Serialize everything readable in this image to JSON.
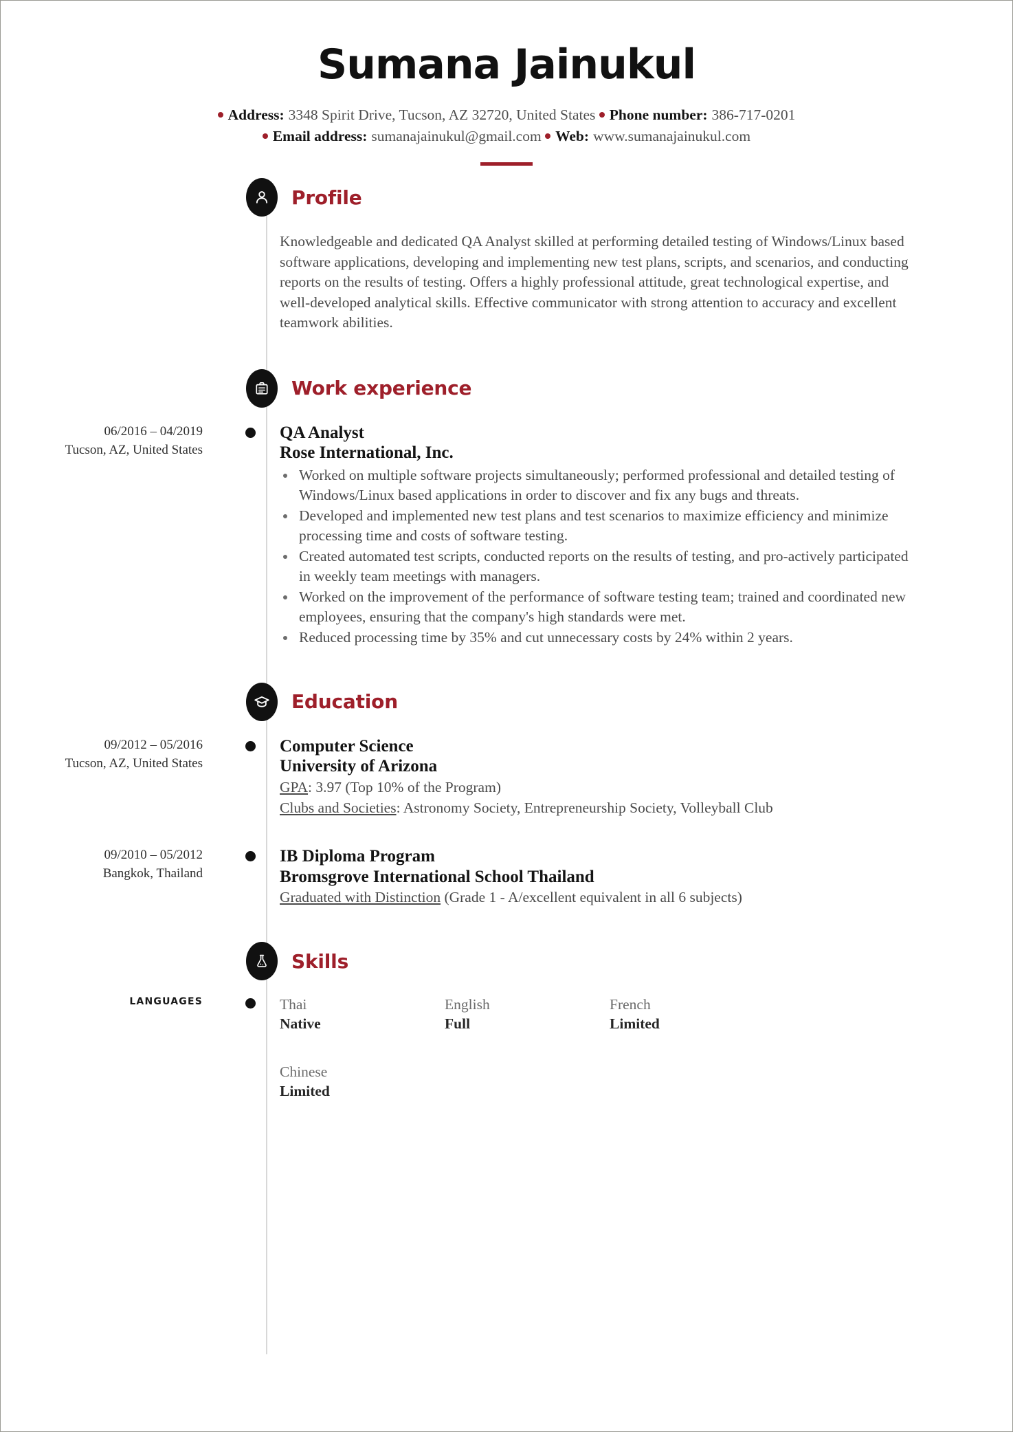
{
  "header": {
    "full_name": "Sumana Jainukul",
    "contact_line_1": [
      {
        "label": "Address:",
        "value": "3348 Spirit Drive, Tucson, AZ 32720, United States"
      },
      {
        "label": "Phone number:",
        "value": "386-717-0201"
      }
    ],
    "contact_line_2": [
      {
        "label": "Email address:",
        "value": "sumanajainukul@gmail.com"
      },
      {
        "label": "Web:",
        "value": "www.sumanajainukul.com"
      }
    ]
  },
  "accent_color": "#9e1f2a",
  "sections": {
    "profile": {
      "title": "Profile",
      "icon": "person-icon",
      "text": "Knowledgeable and dedicated QA Analyst skilled at performing detailed testing of Windows/Linux based software applications, developing and implementing new test plans, scripts, and scenarios, and conducting reports on the results of testing. Offers a highly professional attitude, great technological expertise, and well-developed analytical skills. Effective communicator with strong attention to accuracy and excellent teamwork abilities."
    },
    "work_experience": {
      "title": "Work experience",
      "icon": "briefcase-icon",
      "entries": [
        {
          "date": "06/2016 – 04/2019",
          "location": "Tucson, AZ, United States",
          "title": "QA Analyst",
          "organization": "Rose International, Inc.",
          "bullets": [
            "Worked on multiple software projects simultaneously; performed professional and detailed testing of Windows/Linux based applications in order to discover and fix any bugs and threats.",
            "Developed and implemented new test plans and test scenarios to maximize efficiency and minimize processing time and costs of software testing.",
            "Created automated test scripts, conducted reports on the results of testing, and pro-actively participated in weekly team meetings with managers.",
            "Worked on the improvement of the performance of software testing team; trained and coordinated new employees, ensuring that the company's high standards were met.",
            "Reduced processing time by 35% and cut unnecessary costs by 24% within 2 years."
          ]
        }
      ]
    },
    "education": {
      "title": "Education",
      "icon": "graduation-cap-icon",
      "entries": [
        {
          "date": "09/2012 – 05/2016",
          "location": "Tucson, AZ, United States",
          "degree": "Computer Science",
          "school": "University of Arizona",
          "details": [
            {
              "label": "GPA",
              "rest": ": 3.97 (Top 10% of the Program)"
            },
            {
              "label": "Clubs and Societies",
              "rest": ": Astronomy Society, Entrepreneurship Society, Volleyball Club"
            }
          ]
        },
        {
          "date": "09/2010 – 05/2012",
          "location": "Bangkok, Thailand",
          "degree": "IB Diploma Program",
          "school": "Bromsgrove International School Thailand",
          "details": [
            {
              "label": "Graduated with Distinction",
              "rest": " (Grade 1 - A/excellent equivalent in all 6 subjects)"
            }
          ]
        }
      ]
    },
    "skills": {
      "title": "Skills",
      "icon": "flask-icon",
      "group_label": "LANGUAGES",
      "languages": [
        {
          "name": "Thai",
          "level": "Native"
        },
        {
          "name": "English",
          "level": "Full"
        },
        {
          "name": "French",
          "level": "Limited"
        },
        {
          "name": "Chinese",
          "level": "Limited"
        }
      ]
    }
  }
}
